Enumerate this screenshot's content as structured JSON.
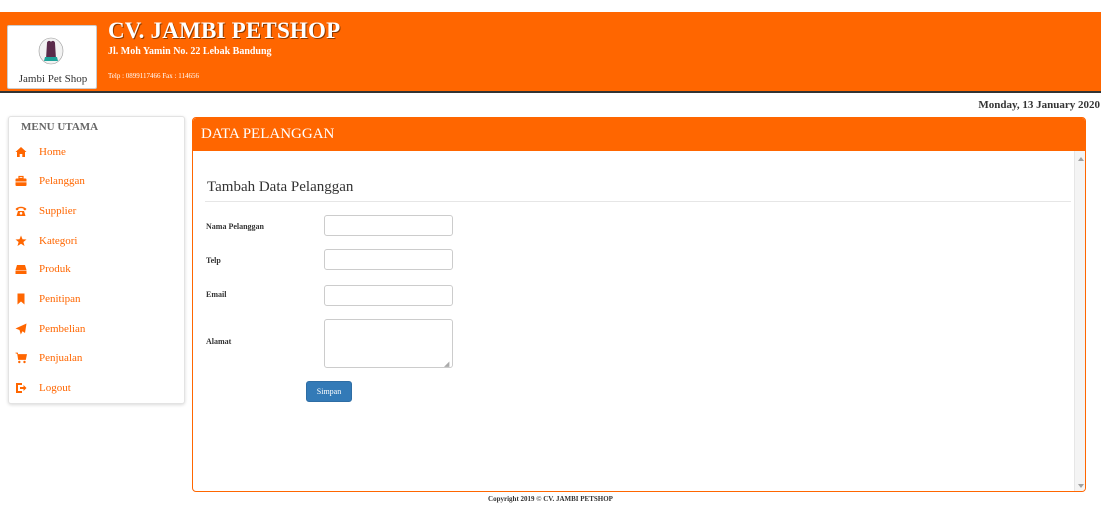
{
  "app": {
    "logo_text": "Jambi Pet Shop",
    "title": "CV. JAMBI PETSHOP",
    "address": "Jl. Moh Yamin No. 22 Lebak Bandung",
    "contact": "Telp : 0899117466 Fax : 114656"
  },
  "date": "Monday, 13 January 2020",
  "sidebar": {
    "heading": "MENU UTAMA",
    "items": [
      {
        "label": "Home",
        "icon": "home-icon"
      },
      {
        "label": "Pelanggan",
        "icon": "briefcase-icon"
      },
      {
        "label": "Supplier",
        "icon": "phone-icon"
      },
      {
        "label": "Kategori",
        "icon": "star-icon"
      },
      {
        "label": "Produk",
        "icon": "hdd-icon"
      },
      {
        "label": "Penitipan",
        "icon": "bookmark-icon"
      },
      {
        "label": "Pembelian",
        "icon": "send-icon"
      },
      {
        "label": "Penjualan",
        "icon": "shopping-cart-icon"
      },
      {
        "label": "Logout",
        "icon": "log-out-icon"
      }
    ]
  },
  "panel": {
    "title": "DATA PELANGGAN",
    "form_title": "Tambah Data Pelanggan",
    "fields": {
      "nama_label": "Nama Pelanggan",
      "nama_value": "",
      "telp_label": "Telp",
      "telp_value": "",
      "email_label": "Email",
      "email_value": "",
      "alamat_label": "Alamat",
      "alamat_value": ""
    },
    "save_label": "Simpan"
  },
  "footer": "Copyright 2019 © CV. JAMBI PETSHOP",
  "colors": {
    "accent": "#ff6600",
    "button": "#337ab7"
  }
}
